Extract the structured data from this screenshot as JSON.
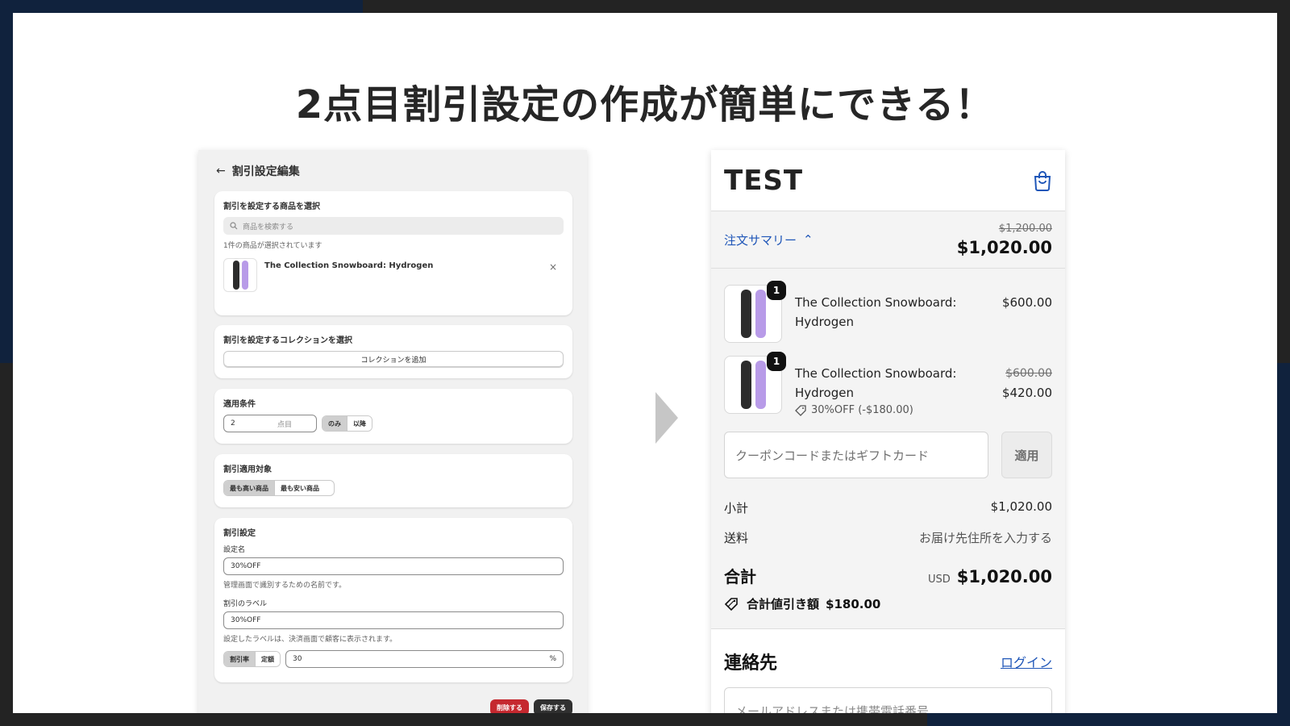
{
  "headline": "2点目割引設定の作成が簡単にできる！",
  "admin": {
    "back_icon": "←",
    "title": "割引設定編集",
    "product_card": {
      "title": "割引を設定する商品を選択",
      "search_placeholder": "商品を検索する",
      "selected_note": "1件の商品が選択されています",
      "product_name": "The Collection Snowboard: Hydrogen",
      "remove_icon": "×"
    },
    "collection_card": {
      "title": "割引を設定するコレクションを選択",
      "add_button": "コレクションを追加"
    },
    "condition_card": {
      "title": "適用条件",
      "quantity_value": "2",
      "quantity_unit": "点目",
      "options": [
        "のみ",
        "以降"
      ],
      "selected": "のみ"
    },
    "target_card": {
      "title": "割引適用対象",
      "options": [
        "最も高い商品",
        "最も安い商品"
      ],
      "selected": "最も高い商品"
    },
    "settings_card": {
      "title": "割引設定",
      "name_label": "設定名",
      "name_value": "30%OFF",
      "name_help": "管理画面で識別するための名前です。",
      "label_label": "割引のラベル",
      "label_value": "30%OFF",
      "label_help": "設定したラベルは、決済画面で顧客に表示されます。",
      "type_options": [
        "割引率",
        "定額"
      ],
      "type_selected": "割引率",
      "amount_value": "30",
      "amount_unit": "%"
    },
    "delete_button": "削除する",
    "save_button": "保存する"
  },
  "checkout": {
    "store_name": "TEST",
    "summary_toggle": "注文サマリー",
    "summary_chevron": "⌃",
    "original_total": "$1,200.00",
    "total": "$1,020.00",
    "line_items": [
      {
        "quantity": "1",
        "name": "The Collection Snowboard: Hydrogen",
        "price": "$600.00",
        "original_price": "",
        "discount": ""
      },
      {
        "quantity": "1",
        "name": "The Collection Snowboard: Hydrogen",
        "price": "$420.00",
        "original_price": "$600.00",
        "discount": "30%OFF (-$180.00)"
      }
    ],
    "coupon_placeholder": "クーポンコードまたはギフトカード",
    "apply_button": "適用",
    "subtotal_label": "小計",
    "subtotal_value": "$1,020.00",
    "shipping_label": "送料",
    "shipping_value": "お届け先住所を入力する",
    "grand_total_label": "合計",
    "currency": "USD",
    "grand_total_value": "$1,020.00",
    "total_savings_label": "合計値引き額",
    "total_savings_value": "$180.00",
    "contact_title": "連絡先",
    "login_link": "ログイン",
    "email_placeholder": "メールアドレスまたは携帯電話番号"
  },
  "colors": {
    "accent_blue": "#1f56b8",
    "danger_red": "#c5282f",
    "navy_background": "#10223d",
    "board_purple": "#b89be8"
  }
}
